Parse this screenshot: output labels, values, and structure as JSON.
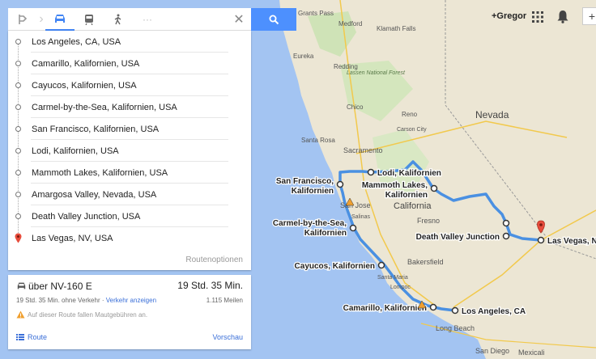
{
  "toolbar": {
    "modes": [
      "directions-icon",
      "car-icon",
      "transit-icon",
      "walk-icon",
      "more-icon"
    ],
    "accent": "#4285f4",
    "search_button_color": "#4d90fe"
  },
  "waypoints": [
    "Los Angeles, CA, USA",
    "Camarillo, Kalifornien, USA",
    "Cayucos, Kalifornien, USA",
    "Carmel-by-the-Sea, Kalifornien, USA",
    "San Francisco, Kalifornien, USA",
    "Lodi, Kalifornien, USA",
    "Mammoth Lakes, Kalifornien, USA",
    "Amargosa Valley, Nevada, USA",
    "Death Valley Junction, USA",
    "Las Vegas, NV, USA"
  ],
  "route_options_label": "Routenoptionen",
  "route": {
    "via": "über NV-160 E",
    "duration": "19 Std. 35 Min.",
    "duration_no_traffic": "19 Std. 35 Min. ohne Verkehr ·",
    "traffic_link": "Verkehr anzeigen",
    "distance": "1.115 Meilen",
    "toll_warning": "Auf dieser Route fallen Mautgebühren an.",
    "route_link": "Route",
    "preview_link": "Vorschau"
  },
  "account": {
    "name": "+Gregor"
  },
  "map": {
    "route_color": "#4a90e2",
    "labels": {
      "grants_pass": "Grants Pass",
      "medford": "Medford",
      "klamath_falls": "Klamath Falls",
      "eureka": "Eureka",
      "redding": "Redding",
      "lassen": "Lassen National Forest",
      "chico": "Chico",
      "reno": "Reno",
      "carson_city": "Carson City",
      "santa_rosa": "Santa Rosa",
      "sacramento": "Sacramento",
      "nevada": "Nevada",
      "california": "California",
      "fresno": "Fresno",
      "bakersfield": "Bakersfield",
      "santa_maria": "Santa Maria",
      "lompoc": "Lompoc",
      "long_beach": "Long Beach",
      "san_diego": "San Diego",
      "mexicali": "Mexicali",
      "san_jose": "San Jose",
      "salinas": "Salinas"
    },
    "markers": {
      "lodi": "Lodi, Kalifornien",
      "san_francisco": [
        "San Francisco,",
        "Kalifornien"
      ],
      "mammoth": [
        "Mammoth Lakes,",
        "Kalifornien"
      ],
      "carmel": [
        "Carmel-by-the-Sea,",
        "Kalifornien"
      ],
      "death_valley": "Death Valley Junction",
      "las_vegas": "Las Vegas, N",
      "cayucos": "Cayucos, Kalifornien",
      "camarillo": "Camarillo, Kalifornien",
      "los_angeles": "Los Angeles, CA"
    }
  }
}
